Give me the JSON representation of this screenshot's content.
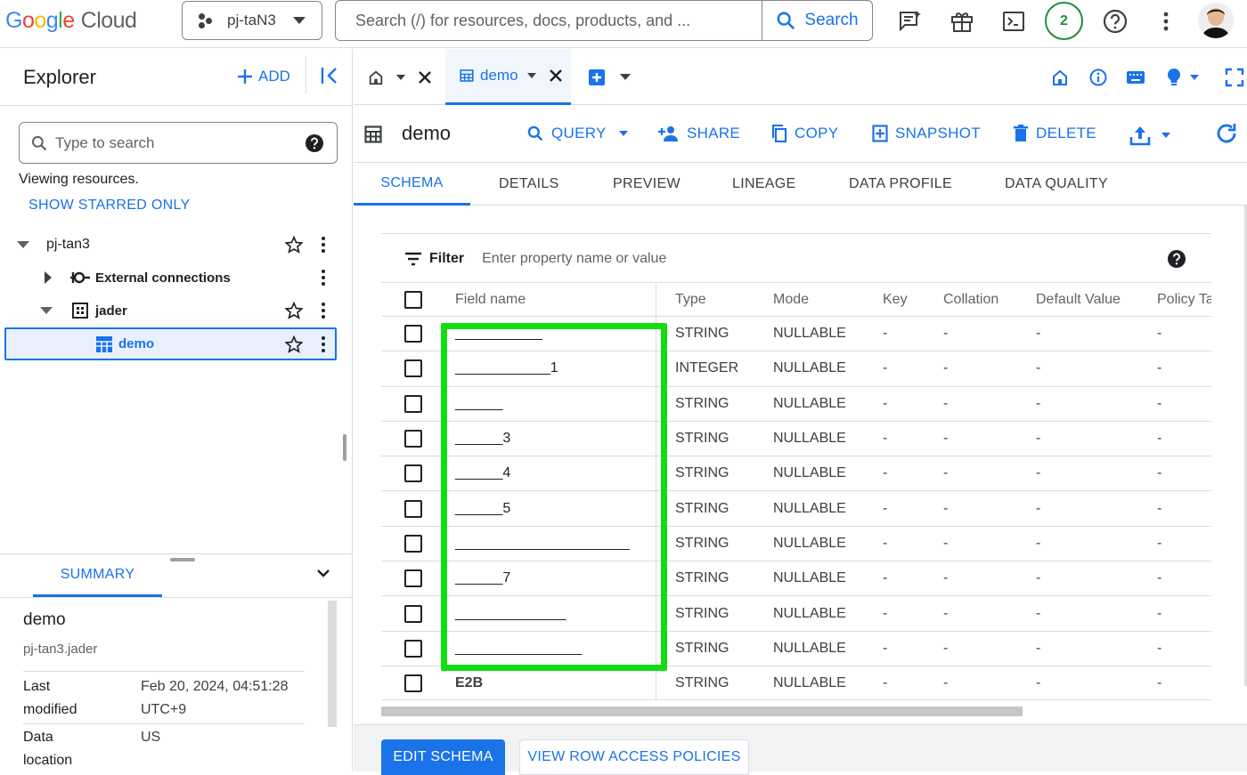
{
  "topbar": {
    "logo_letters": [
      "G",
      "o",
      "o",
      "g",
      "l",
      "e"
    ],
    "logo_cloud": "Cloud",
    "project": "pj-taN3",
    "search_placeholder": "Search (/) for resources, docs, products, and ...",
    "search_button": "Search",
    "notifications_count": "2"
  },
  "explorer": {
    "title": "Explorer",
    "add_label": "ADD",
    "search_placeholder": "Type to search",
    "viewing": "Viewing resources.",
    "show_starred": "SHOW STARRED ONLY",
    "tree": [
      {
        "label": "pj-tan3"
      },
      {
        "label": "External connections"
      },
      {
        "label": "jader"
      },
      {
        "label": "demo"
      }
    ]
  },
  "summary": {
    "tab": "SUMMARY",
    "name": "demo",
    "path": "pj-tan3.jader",
    "rows": [
      {
        "key_1": "Last",
        "key_2": "modified",
        "val_1": "Feb 20, 2024, 04:51:28",
        "val_2": "UTC+9"
      },
      {
        "key_1": "Data",
        "key_2": "location",
        "val_1": "US",
        "val_2": ""
      }
    ]
  },
  "tabs": {
    "active_label": "demo"
  },
  "header": {
    "title": "demo",
    "actions": {
      "query": "QUERY",
      "share": "SHARE",
      "copy": "COPY",
      "snapshot": "SNAPSHOT",
      "delete": "DELETE"
    }
  },
  "subtabs": [
    "SCHEMA",
    "DETAILS",
    "PREVIEW",
    "LINEAGE",
    "DATA PROFILE",
    "DATA QUALITY"
  ],
  "filter": {
    "label": "Filter",
    "placeholder": "Enter property name or value"
  },
  "schema": {
    "columns": [
      "Field name",
      "Type",
      "Mode",
      "Key",
      "Collation",
      "Default Value",
      "Policy Ta"
    ],
    "rows": [
      {
        "field": "___________",
        "type": "STRING",
        "mode": "NULLABLE",
        "key": "-",
        "collation": "-",
        "default": "-",
        "policy": "-"
      },
      {
        "field": "____________1",
        "type": "INTEGER",
        "mode": "NULLABLE",
        "key": "-",
        "collation": "-",
        "default": "-",
        "policy": "-"
      },
      {
        "field": "______",
        "type": "STRING",
        "mode": "NULLABLE",
        "key": "-",
        "collation": "-",
        "default": "-",
        "policy": "-"
      },
      {
        "field": "______3",
        "type": "STRING",
        "mode": "NULLABLE",
        "key": "-",
        "collation": "-",
        "default": "-",
        "policy": "-"
      },
      {
        "field": "______4",
        "type": "STRING",
        "mode": "NULLABLE",
        "key": "-",
        "collation": "-",
        "default": "-",
        "policy": "-"
      },
      {
        "field": "______5",
        "type": "STRING",
        "mode": "NULLABLE",
        "key": "-",
        "collation": "-",
        "default": "-",
        "policy": "-"
      },
      {
        "field": "______________________",
        "type": "STRING",
        "mode": "NULLABLE",
        "key": "-",
        "collation": "-",
        "default": "-",
        "policy": "-"
      },
      {
        "field": "______7",
        "type": "STRING",
        "mode": "NULLABLE",
        "key": "-",
        "collation": "-",
        "default": "-",
        "policy": "-"
      },
      {
        "field": "______________",
        "type": "STRING",
        "mode": "NULLABLE",
        "key": "-",
        "collation": "-",
        "default": "-",
        "policy": "-"
      },
      {
        "field": "________________",
        "type": "STRING",
        "mode": "NULLABLE",
        "key": "-",
        "collation": "-",
        "default": "-",
        "policy": "-"
      },
      {
        "field": "E2B",
        "type": "STRING",
        "mode": "NULLABLE",
        "key": "-",
        "collation": "-",
        "default": "-",
        "policy": "-"
      }
    ]
  },
  "footer": {
    "edit_schema": "EDIT SCHEMA",
    "row_access": "VIEW ROW ACCESS POLICIES"
  },
  "colors": {
    "accent": "#1a73e8",
    "highlight": "#12dd12",
    "badge": "#1e8e3e"
  }
}
